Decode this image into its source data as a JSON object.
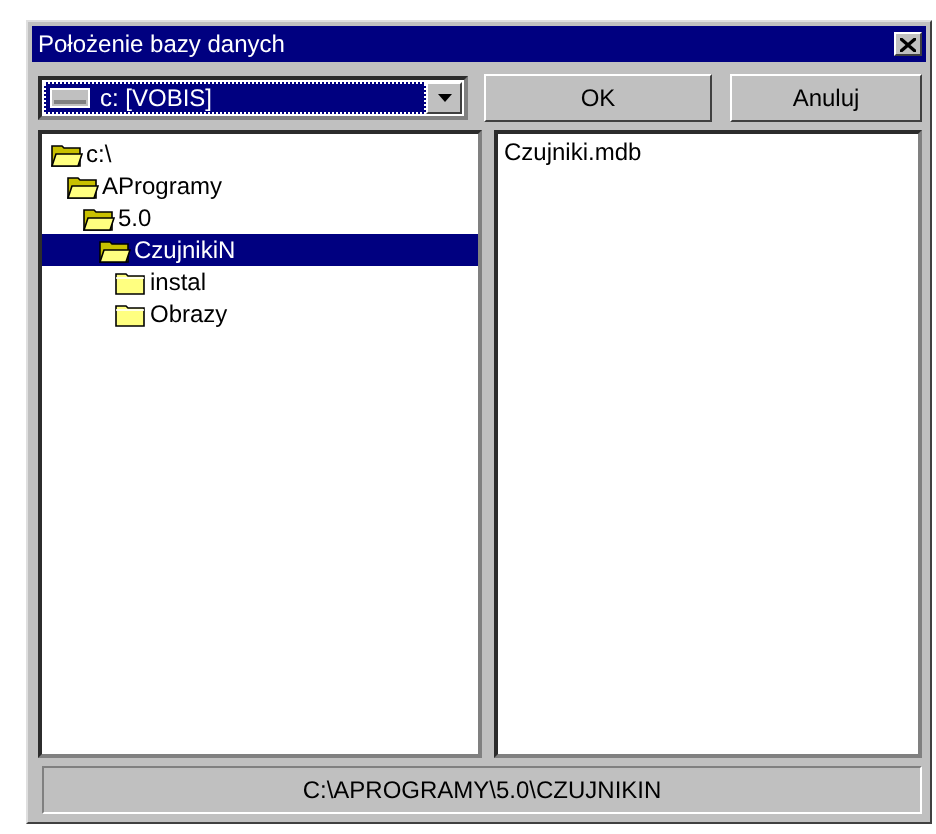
{
  "window": {
    "title": "Położenie bazy danych"
  },
  "drive": {
    "value": "c: [VOBIS]"
  },
  "buttons": [
    "OK",
    "Anuluj"
  ],
  "tree": [
    {
      "label": "c:\\",
      "open": true,
      "selected": false,
      "children": [
        {
          "label": "AProgramy",
          "open": true,
          "selected": false,
          "children": [
            {
              "label": "5.0",
              "open": true,
              "selected": false,
              "children": [
                {
                  "label": "CzujnikiN",
                  "open": true,
                  "selected": true,
                  "children": [
                    {
                      "label": "instal",
                      "open": false,
                      "selected": false
                    },
                    {
                      "label": "Obrazy",
                      "open": false,
                      "selected": false
                    }
                  ]
                }
              ]
            }
          ]
        }
      ]
    }
  ],
  "files": [
    {
      "name": "Czujniki.mdb",
      "selected": false
    }
  ],
  "status_bar": "C:\\APROGRAMY\\5.0\\CZUJNIKIN"
}
